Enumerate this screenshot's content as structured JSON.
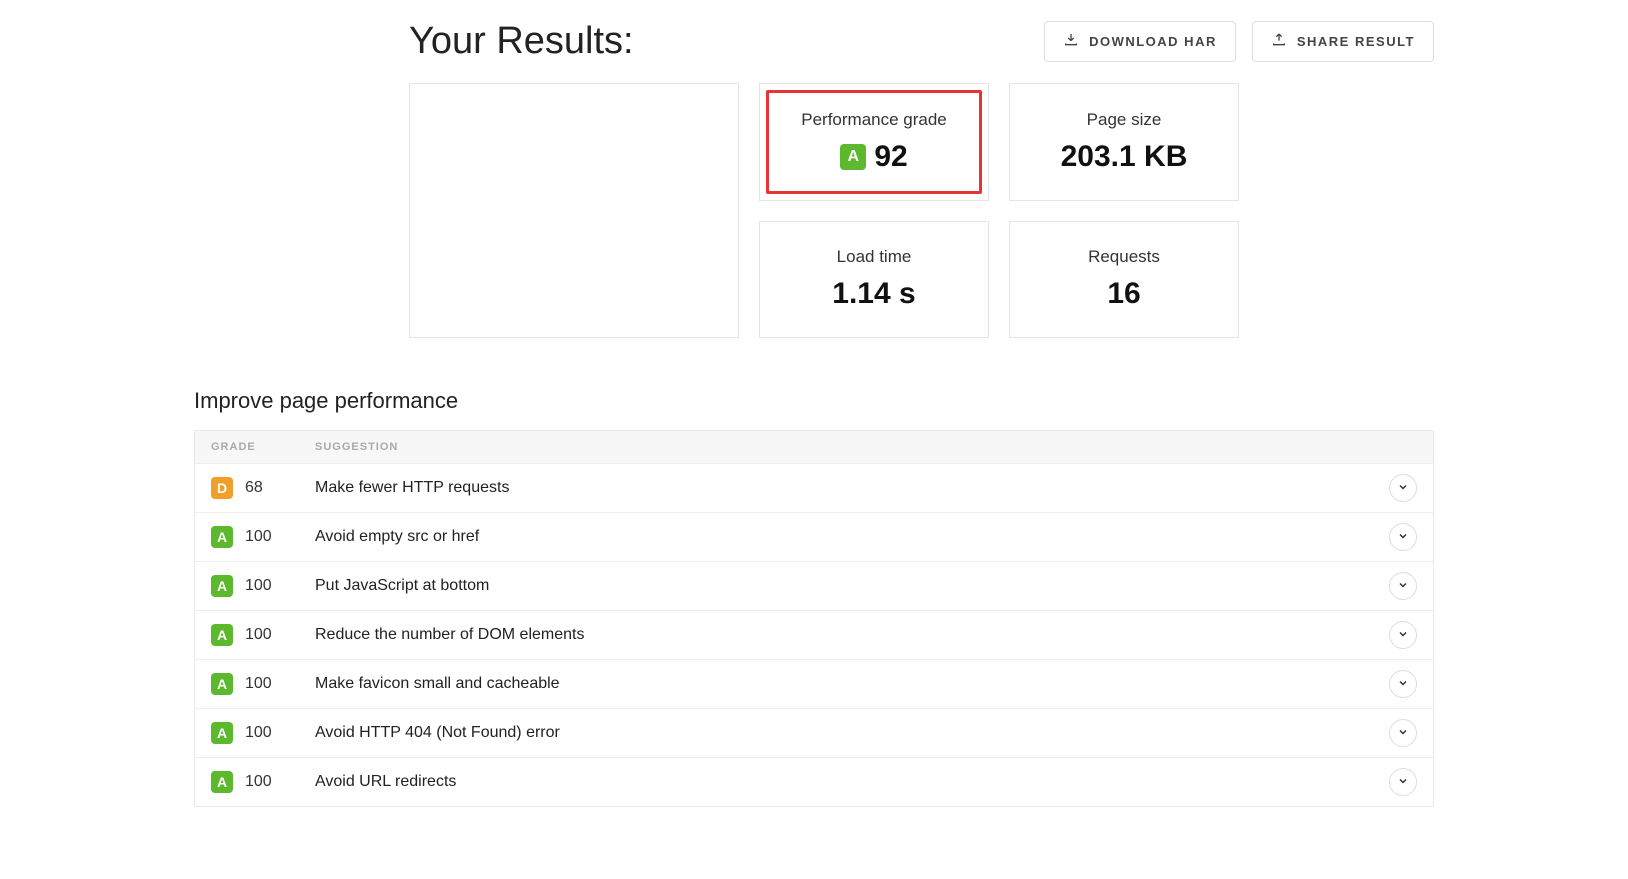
{
  "header": {
    "title": "Your Results:",
    "download_har_label": "DOWNLOAD HAR",
    "share_result_label": "SHARE RESULT"
  },
  "metrics": {
    "performance_grade": {
      "label": "Performance grade",
      "grade_letter": "A",
      "score": "92",
      "highlighted": true
    },
    "page_size": {
      "label": "Page size",
      "value": "203.1 KB"
    },
    "load_time": {
      "label": "Load time",
      "value": "1.14 s"
    },
    "requests": {
      "label": "Requests",
      "value": "16"
    }
  },
  "improve_section": {
    "heading": "Improve page performance",
    "columns": {
      "grade": "GRADE",
      "suggestion": "SUGGESTION"
    },
    "rows": [
      {
        "grade_letter": "D",
        "score": "68",
        "suggestion": "Make fewer HTTP requests"
      },
      {
        "grade_letter": "A",
        "score": "100",
        "suggestion": "Avoid empty src or href"
      },
      {
        "grade_letter": "A",
        "score": "100",
        "suggestion": "Put JavaScript at bottom"
      },
      {
        "grade_letter": "A",
        "score": "100",
        "suggestion": "Reduce the number of DOM elements"
      },
      {
        "grade_letter": "A",
        "score": "100",
        "suggestion": "Make favicon small and cacheable"
      },
      {
        "grade_letter": "A",
        "score": "100",
        "suggestion": "Avoid HTTP 404 (Not Found) error"
      },
      {
        "grade_letter": "A",
        "score": "100",
        "suggestion": "Avoid URL redirects"
      }
    ]
  }
}
